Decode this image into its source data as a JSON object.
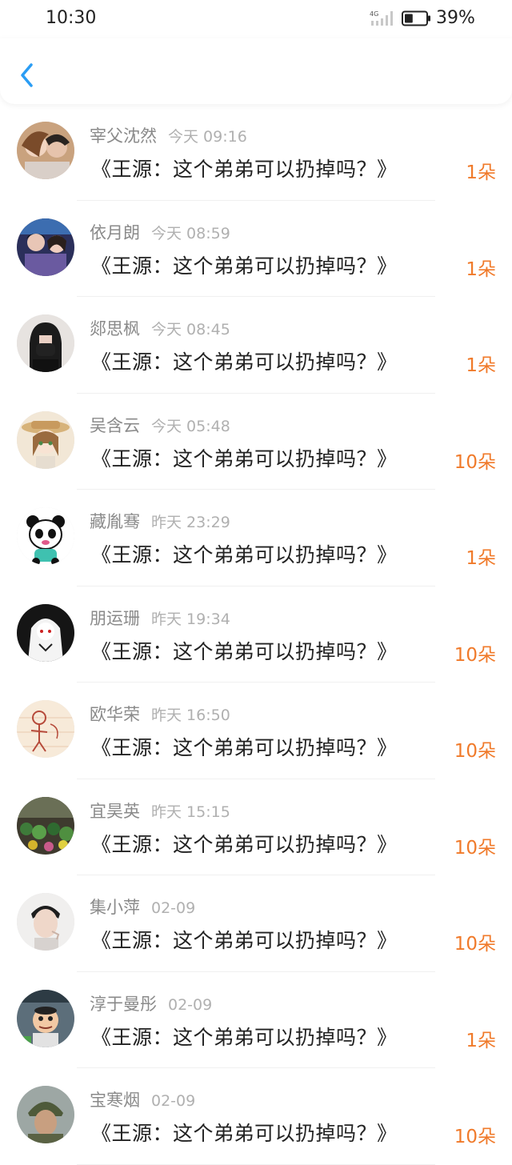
{
  "status_bar": {
    "time": "10:30",
    "network": "4G",
    "battery": "39%",
    "battery_level": 0.39
  },
  "nav": {
    "back_icon": "chevron-left-icon"
  },
  "colors": {
    "accent": "#2a9df4",
    "count": "#f07a2a"
  },
  "items": [
    {
      "name": "宰父沈然",
      "date": "今天 09:16",
      "message": "《王源：这个弟弟可以扔掉吗？》",
      "count": "1朵"
    },
    {
      "name": "依月朗",
      "date": "今天 08:59",
      "message": "《王源：这个弟弟可以扔掉吗？》",
      "count": "1朵"
    },
    {
      "name": "郯思枫",
      "date": "今天 08:45",
      "message": "《王源：这个弟弟可以扔掉吗？》",
      "count": "1朵"
    },
    {
      "name": "吴含云",
      "date": "今天 05:48",
      "message": "《王源：这个弟弟可以扔掉吗？》",
      "count": "10朵"
    },
    {
      "name": "藏胤骞",
      "date": "昨天 23:29",
      "message": "《王源：这个弟弟可以扔掉吗？》",
      "count": "1朵"
    },
    {
      "name": "朋运珊",
      "date": "昨天 19:34",
      "message": "《王源：这个弟弟可以扔掉吗？》",
      "count": "10朵"
    },
    {
      "name": "欧华荣",
      "date": "昨天 16:50",
      "message": "《王源：这个弟弟可以扔掉吗？》",
      "count": "10朵"
    },
    {
      "name": "宜昊英",
      "date": "昨天 15:15",
      "message": "《王源：这个弟弟可以扔掉吗？》",
      "count": "10朵"
    },
    {
      "name": "集小萍",
      "date": "02-09",
      "message": "《王源：这个弟弟可以扔掉吗？》",
      "count": "10朵"
    },
    {
      "name": "淳于曼彤",
      "date": "02-09",
      "message": "《王源：这个弟弟可以扔掉吗？》",
      "count": "1朵"
    },
    {
      "name": "宝寒烟",
      "date": "02-09",
      "message": "《王源：这个弟弟可以扔掉吗？》",
      "count": "10朵"
    }
  ]
}
